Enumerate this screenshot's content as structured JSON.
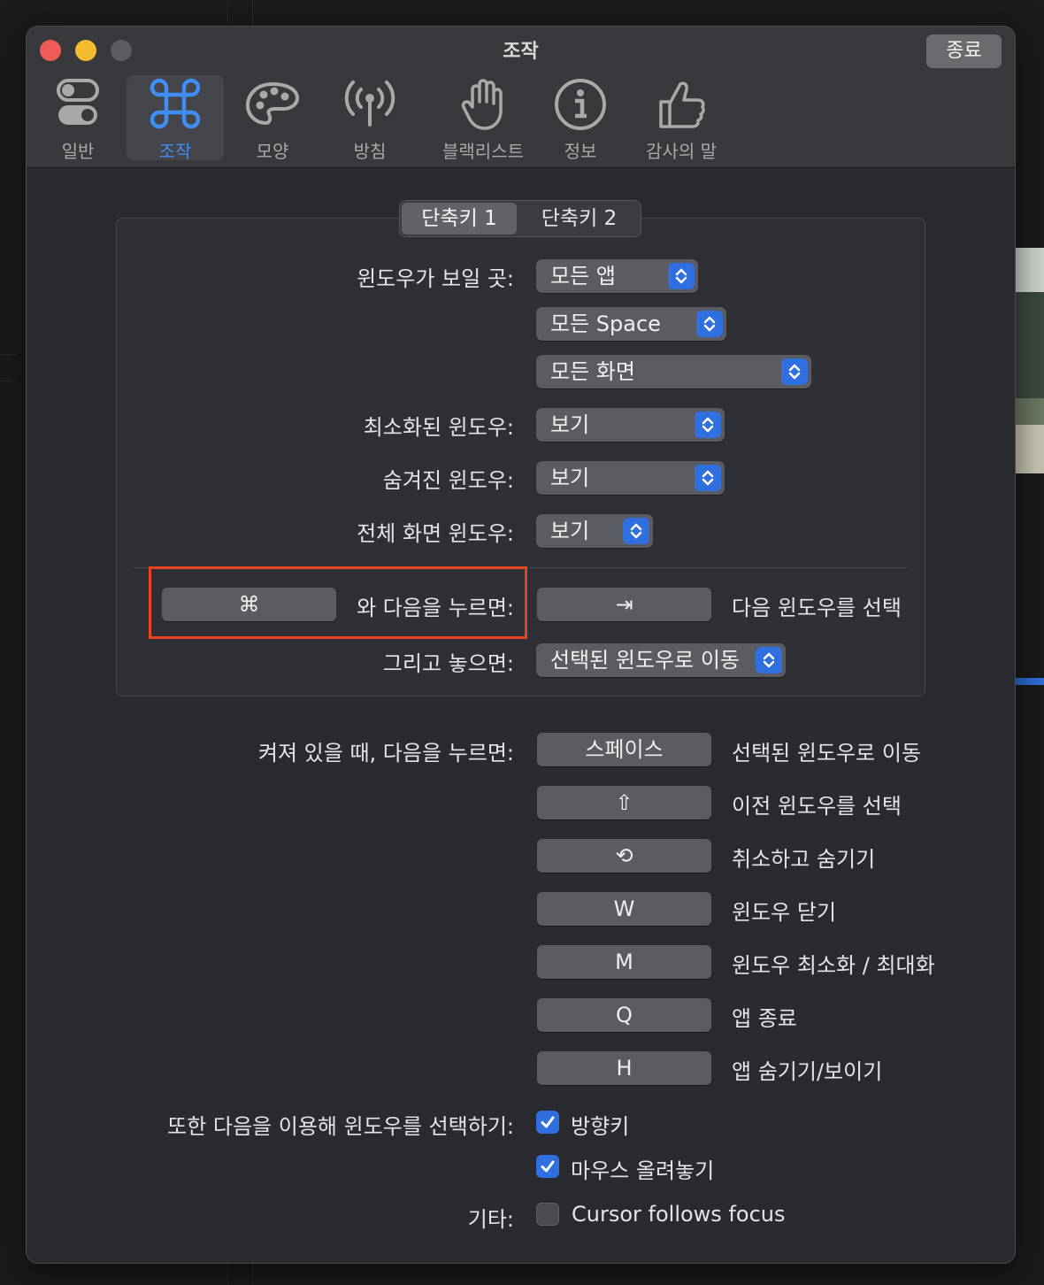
{
  "window": {
    "title": "조작",
    "quit_label": "종료"
  },
  "toolbar": {
    "tabs": [
      {
        "label": "일반",
        "icon": "toggles-icon"
      },
      {
        "label": "조작",
        "icon": "command-icon"
      },
      {
        "label": "모양",
        "icon": "palette-icon"
      },
      {
        "label": "방침",
        "icon": "antenna-icon"
      },
      {
        "label": "블랙리스트",
        "icon": "hand-icon"
      },
      {
        "label": "정보",
        "icon": "info-icon"
      },
      {
        "label": "감사의 말",
        "icon": "thumbs-up-icon"
      }
    ],
    "active_tab": "조작"
  },
  "segmented": {
    "items": [
      "단축키 1",
      "단축키 2"
    ],
    "selected": "단축키 1"
  },
  "settings": {
    "show_windows_label": "윈도우가 보일 곳:",
    "apps_value": "모든 앱",
    "spaces_value": "모든 Space",
    "screens_value": "모든 화면",
    "minimized_label": "최소화된 윈도우:",
    "minimized_value": "보기",
    "hidden_label": "숨겨진 윈도우:",
    "hidden_value": "보기",
    "fullscreen_label": "전체 화면 윈도우:",
    "fullscreen_value": "보기",
    "hold_key": "⌘",
    "hold_label": "와 다음을 누르면:",
    "next_key": "⇥",
    "next_desc": "다음 윈도우를 선택",
    "release_label": "그리고 놓으면:",
    "release_value": "선택된 윈도우로 이동"
  },
  "shortcuts": {
    "label": "켜져 있을 때, 다음을 누르면:",
    "items": [
      {
        "key": "스페이스",
        "desc": "선택된 윈도우로 이동"
      },
      {
        "key": "⇧",
        "desc": "이전 윈도우를 선택"
      },
      {
        "key": "⟲",
        "desc": "취소하고 숨기기"
      },
      {
        "key": "W",
        "desc": "윈도우 닫기"
      },
      {
        "key": "M",
        "desc": "윈도우 최소화 / 최대화"
      },
      {
        "key": "Q",
        "desc": "앱 종료"
      },
      {
        "key": "H",
        "desc": "앱 숨기기/보이기"
      }
    ]
  },
  "also_select": {
    "label": "또한 다음을 이용해 윈도우를 선택하기:",
    "arrow_keys": {
      "label": "방향키",
      "checked": true
    },
    "mouse_hover": {
      "label": "마우스 올려놓기",
      "checked": true
    }
  },
  "misc": {
    "label": "기타:",
    "cursor_follows": {
      "label": "Cursor follows focus",
      "checked": false
    }
  },
  "colors": {
    "accent": "#2f6fe0",
    "active_tab_text": "#3f8ef5",
    "highlight_box": "#e8421e"
  }
}
